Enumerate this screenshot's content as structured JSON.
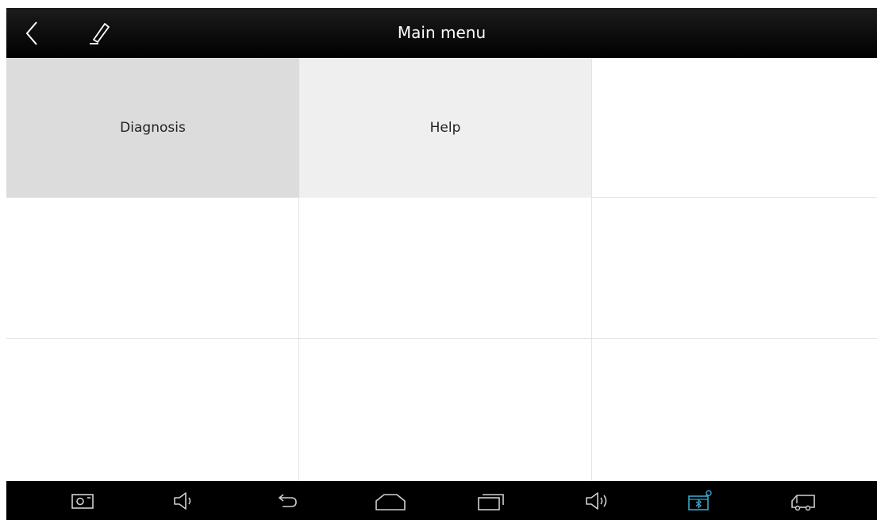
{
  "titlebar": {
    "title": "Main menu",
    "back_icon": "chevron-left-icon",
    "edit_icon": "pen-icon"
  },
  "menu": {
    "items": [
      {
        "label": "Diagnosis"
      },
      {
        "label": "Help"
      }
    ]
  },
  "navbar": {
    "icons": [
      "screenshot-icon",
      "volume-down-icon",
      "back-icon",
      "home-icon",
      "recent-apps-icon",
      "volume-up-icon",
      "bluetooth-vci-icon",
      "truck-icon"
    ]
  },
  "colors": {
    "titlebar_bg": "#000000",
    "selected_cell": "#dcdcdc",
    "help_cell": "#efefef",
    "accent": "#3aa6c9"
  }
}
